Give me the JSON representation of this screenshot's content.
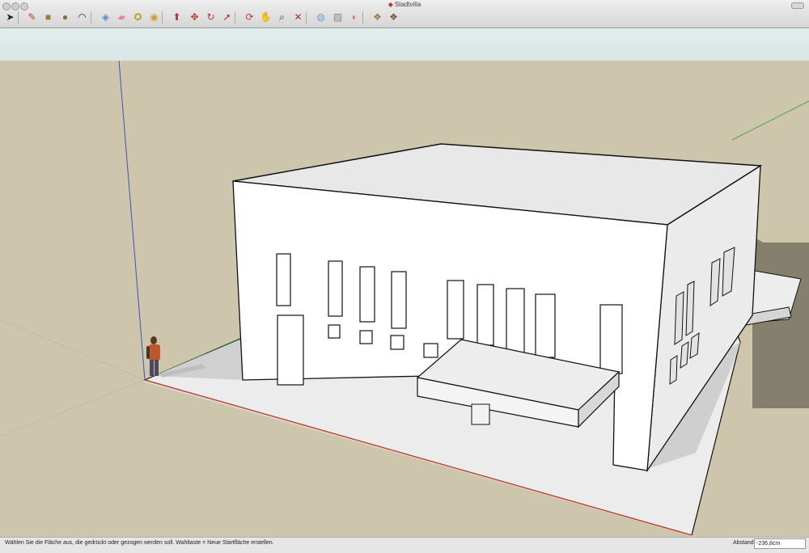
{
  "window": {
    "title": "Stadtvilla"
  },
  "toolbar": {
    "tools": [
      {
        "name": "select-tool-icon",
        "glyph": "➤",
        "color": "#222"
      },
      {
        "name": "pencil-tool-icon",
        "glyph": "✎",
        "color": "#c0392b"
      },
      {
        "name": "rectangle-tool-icon",
        "glyph": "■",
        "color": "#a07a3c"
      },
      {
        "name": "circle-tool-icon",
        "glyph": "●",
        "color": "#8a6a3a"
      },
      {
        "name": "arc-tool-icon",
        "glyph": "◠",
        "color": "#333"
      },
      {
        "name": "make-component-icon",
        "glyph": "◈",
        "color": "#5a8bc4"
      },
      {
        "name": "eraser-tool-icon",
        "glyph": "▰",
        "color": "#e08aa0"
      },
      {
        "name": "tape-measure-icon",
        "glyph": "✪",
        "color": "#b99a2c"
      },
      {
        "name": "paint-bucket-icon",
        "glyph": "◉",
        "color": "#d1a030"
      },
      {
        "name": "push-pull-tool-icon",
        "glyph": "⬆",
        "color": "#b3322a"
      },
      {
        "name": "move-tool-icon",
        "glyph": "✥",
        "color": "#c0392b"
      },
      {
        "name": "rotate-tool-icon",
        "glyph": "↻",
        "color": "#c0392b"
      },
      {
        "name": "offset-tool-icon",
        "glyph": "➚",
        "color": "#b3322a"
      },
      {
        "name": "orbit-tool-icon",
        "glyph": "⟳",
        "color": "#c0392b"
      },
      {
        "name": "pan-tool-icon",
        "glyph": "✋",
        "color": "#666"
      },
      {
        "name": "zoom-tool-icon",
        "glyph": "⌕",
        "color": "#333"
      },
      {
        "name": "zoom-extents-icon",
        "glyph": "✕",
        "color": "#b3322a"
      },
      {
        "name": "3d-warehouse-icon",
        "glyph": "◍",
        "color": "#6aa6d0"
      },
      {
        "name": "share-model-icon",
        "glyph": "▨",
        "color": "#8a8a8a"
      },
      {
        "name": "get-photo-texture-icon",
        "glyph": "◐",
        "color": "#d07a50"
      },
      {
        "name": "components-icon",
        "glyph": "❖",
        "color": "#a07a3c"
      },
      {
        "name": "extension-warehouse-icon",
        "glyph": "❖",
        "color": "#7a5a2c"
      }
    ]
  },
  "status": {
    "text": "Wählen Sie die Fläche aus, die gedrückt oder gezogen werden soll. Wahltaste = Neue Startfläche erstellen.",
    "measure_label": "Abstand",
    "measure_value": "-236,8cm"
  },
  "colors": {
    "ground": "#cdc6ac",
    "sky": "#dfeaea",
    "wall_front": "#ffffff",
    "wall_side": "#eeeeee",
    "roof": "#e6e6e6",
    "base": "#ececec",
    "shadow": "#85806d",
    "axis_red": "#c23b22",
    "axis_green": "#3c9a3c",
    "axis_blue": "#3a55c0"
  }
}
